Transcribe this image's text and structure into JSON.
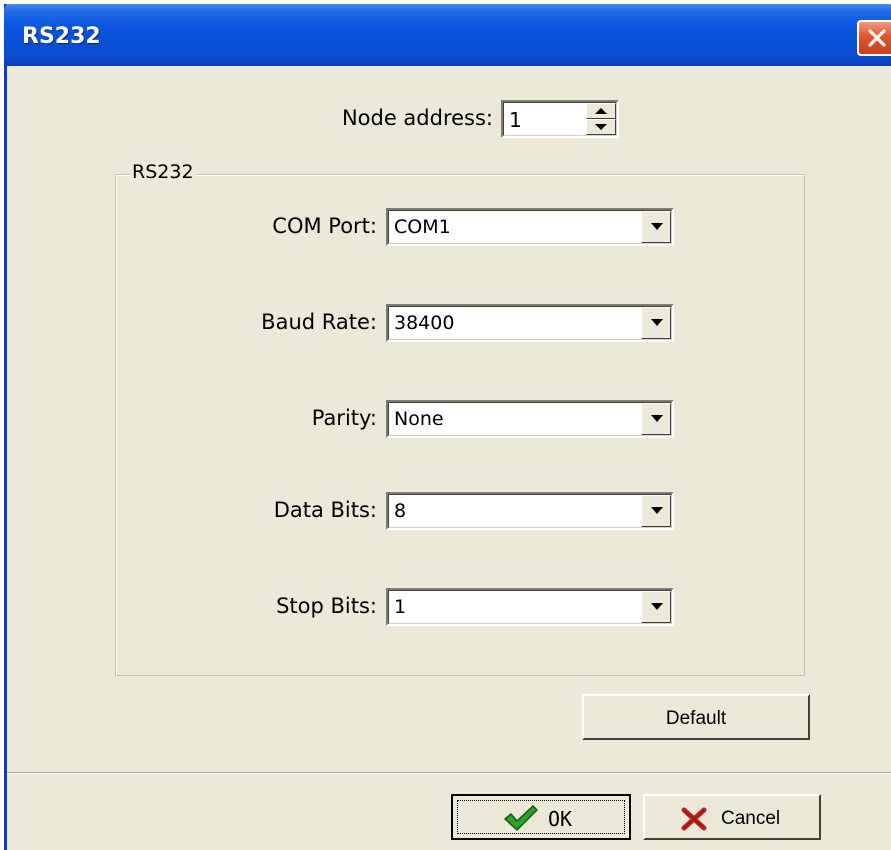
{
  "window": {
    "title": "RS232"
  },
  "node_address": {
    "label": "Node address:",
    "value": "1"
  },
  "group": {
    "title": "RS232"
  },
  "fields": {
    "com_port": {
      "label": "COM Port:",
      "value": "COM1"
    },
    "baud_rate": {
      "label": "Baud Rate:",
      "value": "38400"
    },
    "parity": {
      "label": "Parity:",
      "value": "None"
    },
    "data_bits": {
      "label": "Data Bits:",
      "value": "8"
    },
    "stop_bits": {
      "label": "Stop Bits:",
      "value": "1"
    }
  },
  "buttons": {
    "default_label": "Default",
    "ok_label": "OK",
    "cancel_label": "Cancel"
  },
  "colors": {
    "titlebar": "#0a56e0",
    "dialog_bg": "#ece9d8",
    "close_button": "#e0552e",
    "ok_check": "#2fa02a",
    "cancel_x": "#c4201a"
  },
  "icons": {
    "close": "close-icon",
    "ok": "checkmark-icon",
    "cancel": "x-icon",
    "dropdown": "chevron-down-icon",
    "spin_up": "spin-up-icon",
    "spin_down": "spin-down-icon"
  }
}
